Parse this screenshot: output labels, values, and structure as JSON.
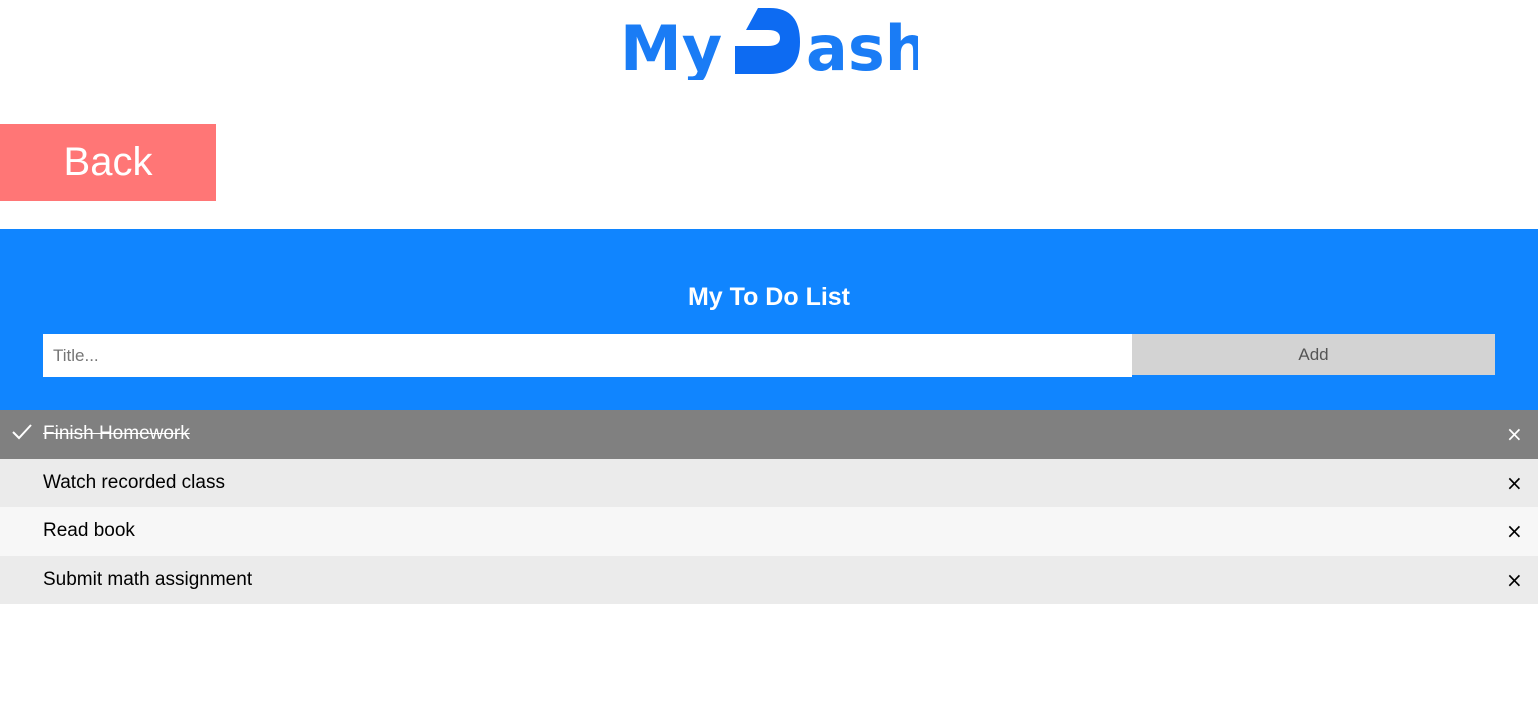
{
  "logo": {
    "part1": "My",
    "part2": "ash",
    "color": "#1a7cf5",
    "icon": "d-shape-logo-icon"
  },
  "back_button": {
    "label": "Back",
    "color": "#ff7676"
  },
  "todo": {
    "title": "My To Do List",
    "input_placeholder": "Title...",
    "input_value": "",
    "add_label": "Add",
    "panel_color": "#1085ff",
    "items": [
      {
        "text": "Finish Homework",
        "checked": true
      },
      {
        "text": "Watch recorded class",
        "checked": false
      },
      {
        "text": "Read book",
        "checked": false
      },
      {
        "text": "Submit math assignment",
        "checked": false
      }
    ],
    "close_glyph": "×",
    "check_icon": "checkmark-icon",
    "close_icon": "close-icon"
  }
}
